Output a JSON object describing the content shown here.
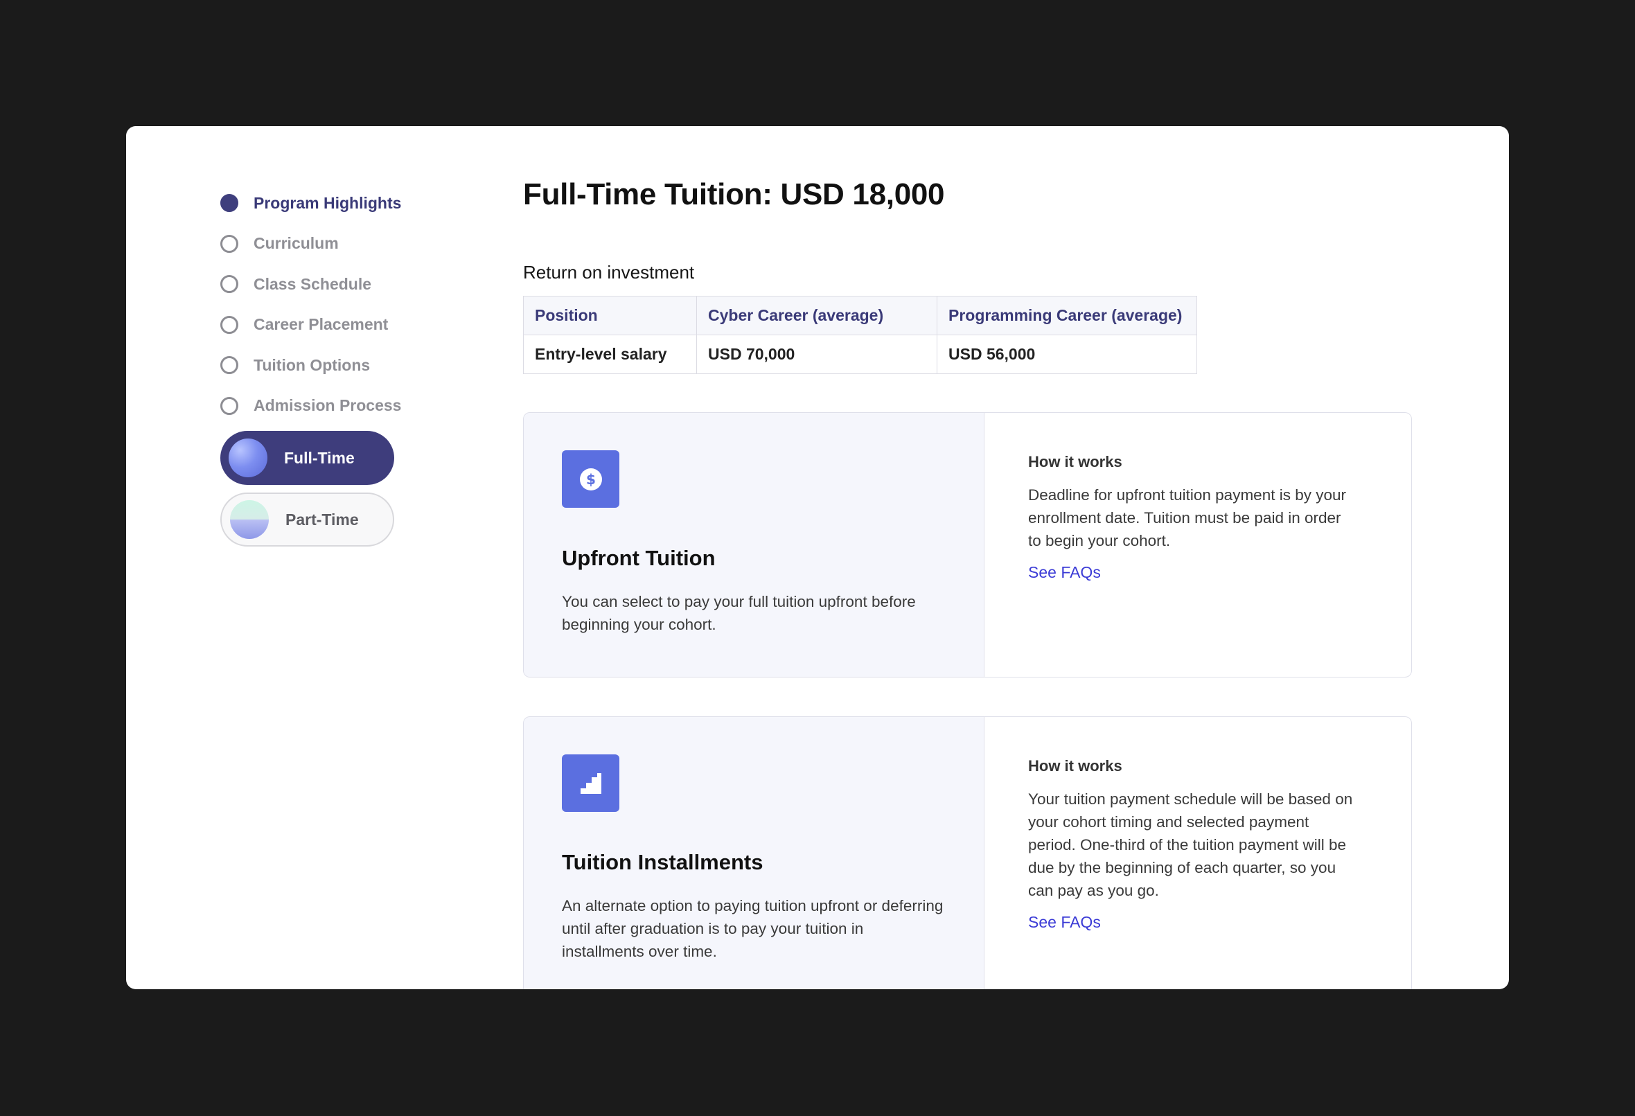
{
  "sidebar": {
    "items": [
      {
        "label": "Program Highlights",
        "active": true
      },
      {
        "label": "Curriculum",
        "active": false
      },
      {
        "label": "Class Schedule",
        "active": false
      },
      {
        "label": "Career Placement",
        "active": false
      },
      {
        "label": "Tuition Options",
        "active": false
      },
      {
        "label": "Admission Process",
        "active": false
      }
    ],
    "toggle": {
      "full_time_label": "Full-Time",
      "part_time_label": "Part-Time",
      "selected": "Full-Time"
    }
  },
  "main": {
    "title": "Full-Time Tuition: USD 18,000",
    "roi": {
      "label": "Return on investment",
      "headers": [
        "Position",
        "Cyber Career (average)",
        "Programming Career (average)"
      ],
      "rows": [
        [
          "Entry-level salary",
          "USD 70,000",
          "USD 56,000"
        ]
      ]
    },
    "cards": [
      {
        "icon": "dollar-icon",
        "title": "Upfront Tuition",
        "description": "You can select to pay your full tuition upfront before beginning your cohort.",
        "how_title": "How it works",
        "how_text": "Deadline for upfront tuition payment is by your enrollment date. Tuition must be paid in order to begin your cohort.",
        "link": "See FAQs"
      },
      {
        "icon": "stairs-icon",
        "title": "Tuition Installments",
        "description": "An alternate option to paying tuition upfront or deferring until after graduation is to pay your tuition in installments over time.",
        "how_title": "How it works",
        "how_text": "Your tuition payment schedule will be based on your cohort timing and selected payment period. One-third of the tuition payment will be due by the beginning of each quarter, so you can pay as you go.",
        "link": "See FAQs"
      }
    ]
  },
  "colors": {
    "background": "#1b1b1b",
    "accent": "#3e3d7c",
    "icon_bg": "#5b6fe0",
    "link": "#3b3bd6"
  }
}
